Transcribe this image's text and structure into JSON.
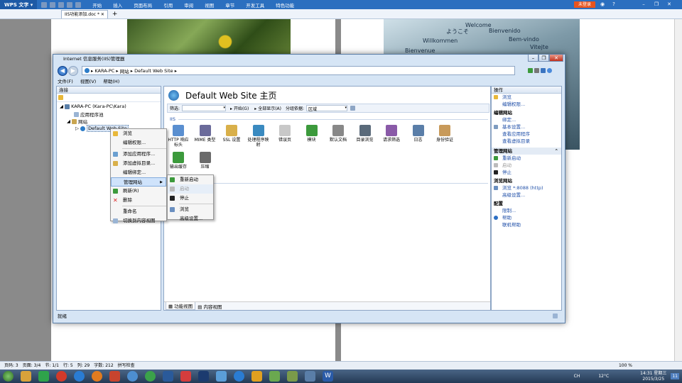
{
  "wps": {
    "app": "WPS 文字",
    "menus": [
      "开始",
      "插入",
      "页面布局",
      "引用",
      "审阅",
      "视图",
      "章节",
      "开发工具",
      "特色功能"
    ],
    "unlogin": "未登录",
    "doc_tab": "IIS功能添加.doc *",
    "new_tab": "+"
  },
  "photo2_words": [
    "Welcome",
    "ようこそ",
    "Bienvenido",
    "Willkommen",
    "Bem-vindo",
    "Bienvenue",
    "Vitejte"
  ],
  "iis": {
    "title": "Internet 信息服务(IIS)管理器",
    "address": [
      "KARA-PC",
      "网站",
      "Default Web Site"
    ],
    "menu": [
      "文件(F)",
      "视图(V)",
      "帮助(H)"
    ],
    "status": "就绪"
  },
  "conn": {
    "header": "连接",
    "tree": [
      "KARA-PC (Kara-PC\\Kara)",
      "应用程序池",
      "网站",
      "Default Web Site"
    ]
  },
  "ctx": {
    "items": [
      "浏览",
      "编辑权限...",
      "添加应用程序...",
      "添加虚拟目录...",
      "编辑绑定...",
      "管理网站",
      "刷新(R)",
      "删除",
      "重命名",
      "切换到内容视图"
    ],
    "arrow": "▶"
  },
  "sub": {
    "items": [
      "重新启动",
      "启动",
      "停止",
      "浏览",
      "高级设置..."
    ]
  },
  "home": {
    "title": "Default Web Site 主页",
    "filter_label": "筛选:",
    "go": "开始(G)",
    "show_all": "全部显示(A)",
    "group_label": "分组依据:",
    "group_value": "区域",
    "section": "IIS",
    "features": [
      "HTTP 响应标头",
      "MIME 类型",
      "SSL 设置",
      "处理程序映射",
      "错误页",
      "模块",
      "默认文档",
      "目录浏览",
      "请求筛选",
      "日志",
      "身份验证",
      "输出缓存",
      "压缩"
    ],
    "view_feature": "功能视图",
    "view_content": "内容视图"
  },
  "actions": {
    "header": "操作",
    "items1": [
      "浏览",
      "编辑权限..."
    ],
    "sec_edit": "编辑网站",
    "items2": [
      "绑定...",
      "基本设置..."
    ],
    "items3": [
      "查看应用程序",
      "查看虚拟目录"
    ],
    "sec_manage": "管理网站",
    "manage": [
      "重新启动",
      "启动",
      "停止"
    ],
    "sec_browse": "浏览网站",
    "browse": "浏览 *:8088 (http)",
    "advanced": "高级设置...",
    "sec_config": "配置",
    "limits": "限制...",
    "help": "帮助",
    "online_help": "联机帮助"
  },
  "wps_status": [
    "页码: 3",
    "页面: 3/4",
    "节: 1/1",
    "行: 5",
    "列: 29",
    "字数: 212",
    "拼写检查"
  ],
  "zoom": "100 %",
  "tray": {
    "lang": "CH",
    "temp": "12°C",
    "time": "14:31 星期三",
    "date": "2015/3/25",
    "day": "11"
  },
  "colors": {
    "wps_blue": "#2b6fbf",
    "iis_frame": "#d6e5f5",
    "link": "#1f4fa8",
    "highlight": "#cfe3fb"
  }
}
